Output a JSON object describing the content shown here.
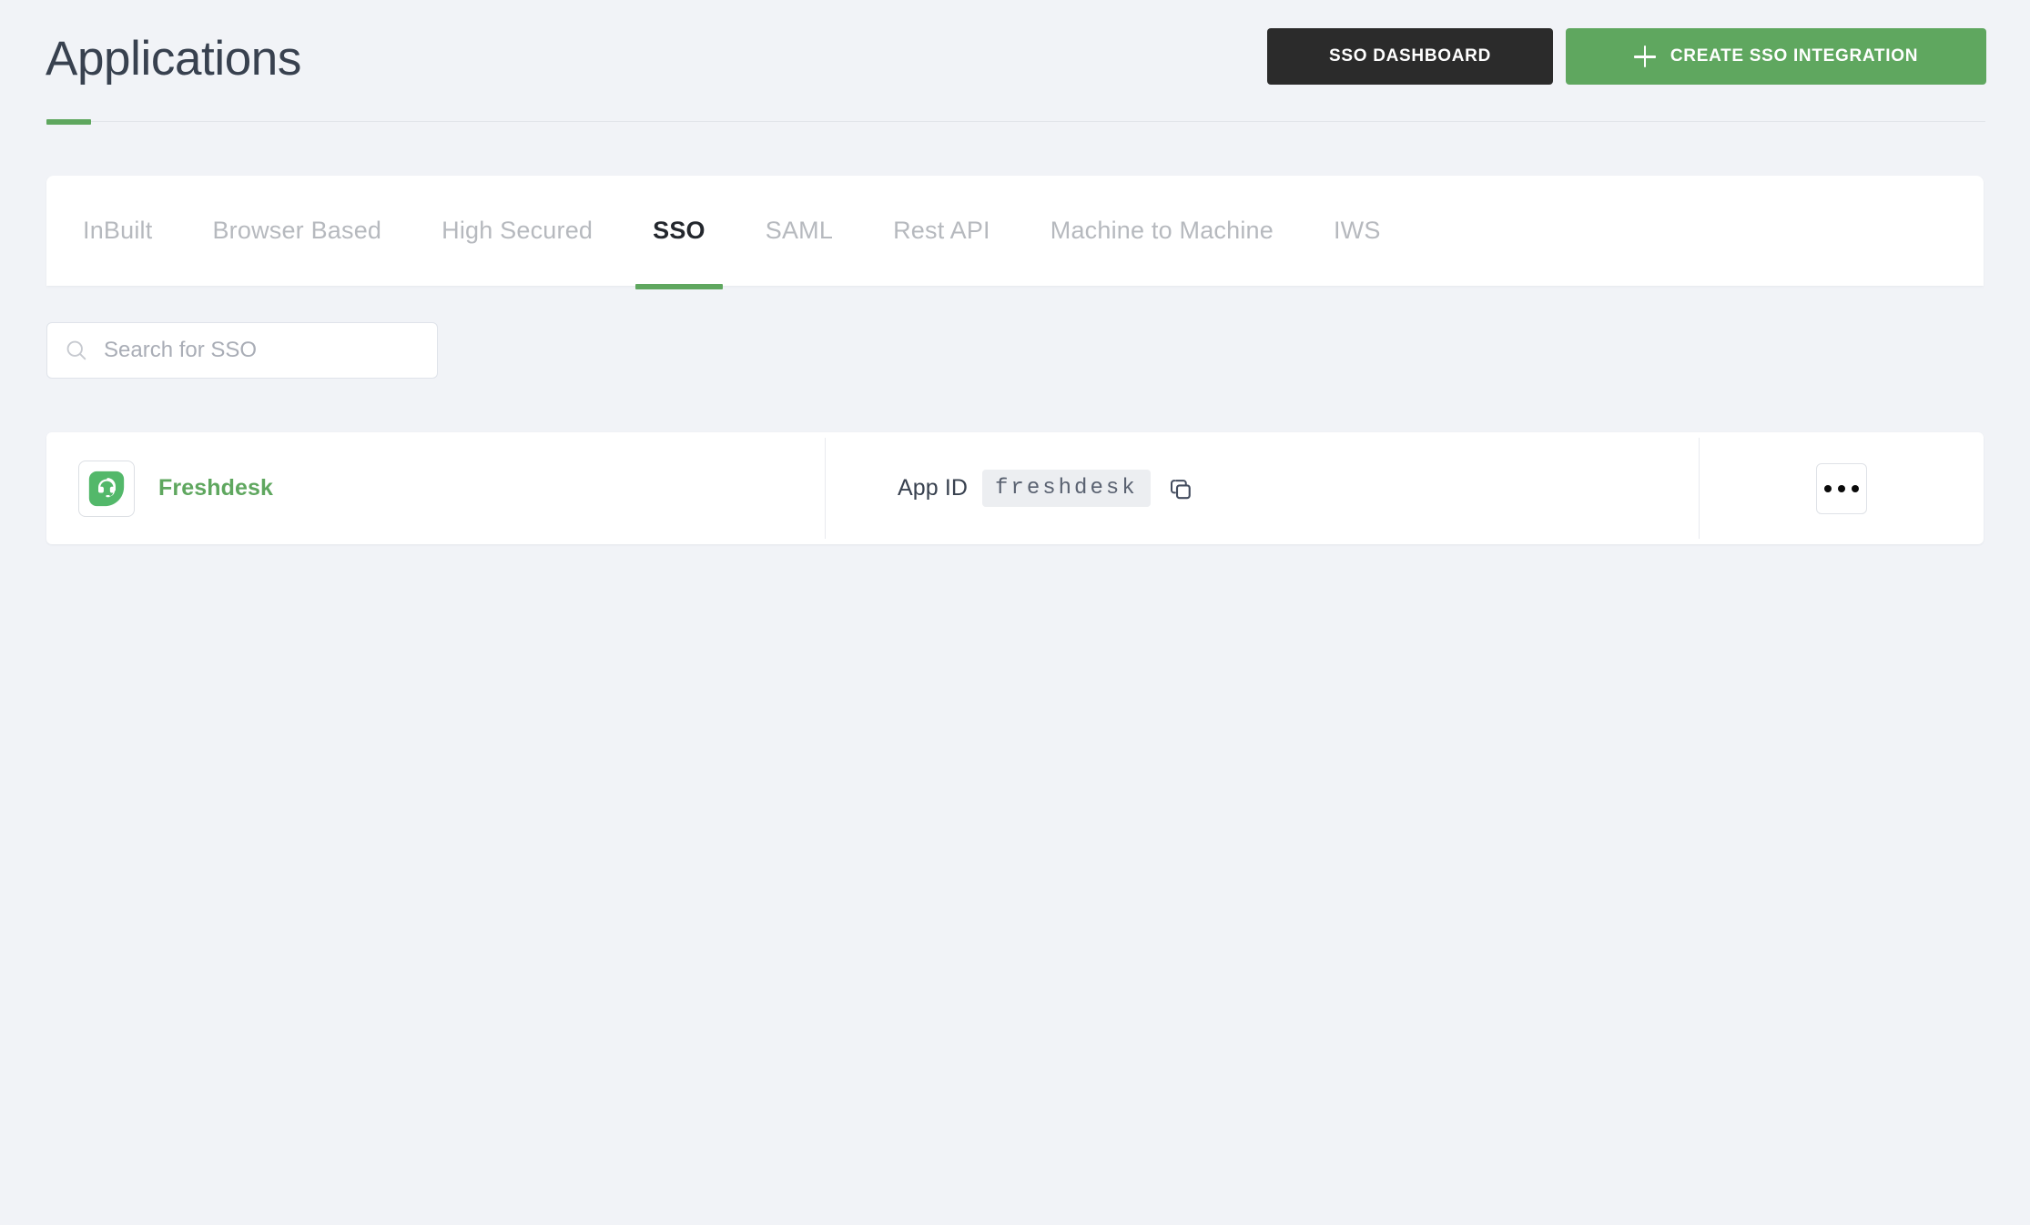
{
  "header": {
    "title": "Applications",
    "accent_color": "#5fa75f",
    "buttons": [
      {
        "label": "SSO DASHBOARD",
        "style": "dark",
        "icon": null
      },
      {
        "label": "CREATE SSO INTEGRATION",
        "style": "green",
        "icon": "plus-icon"
      }
    ]
  },
  "tabs": {
    "active_index": 3,
    "items": [
      {
        "label": "InBuilt"
      },
      {
        "label": "Browser Based"
      },
      {
        "label": "High Secured"
      },
      {
        "label": "SSO"
      },
      {
        "label": "SAML"
      },
      {
        "label": "Rest API"
      },
      {
        "label": "Machine to Machine"
      },
      {
        "label": "IWS"
      }
    ]
  },
  "search": {
    "icon": "search-icon",
    "placeholder": "Search for SSO",
    "value": ""
  },
  "list": {
    "rows": [
      {
        "app_name": "Freshdesk",
        "app_logo": "freshdesk-logo-icon",
        "app_id_label": "App ID",
        "app_id_value": "freshdesk",
        "copy_icon": "copy-icon",
        "more_icon": "more-options-icon"
      }
    ]
  },
  "colors": {
    "page_background": "#f1f3f7",
    "accent_green": "#5fa75f",
    "dark_button": "#2b2b2b",
    "title_text": "#38414f",
    "tab_inactive": "#b6b9be"
  }
}
